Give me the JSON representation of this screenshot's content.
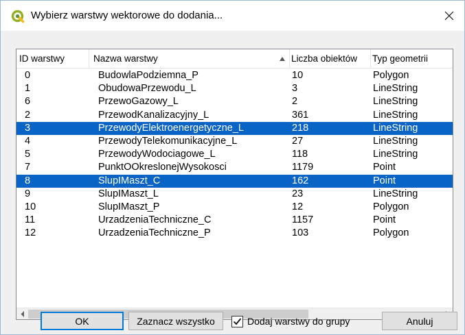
{
  "window": {
    "title": "Wybierz warstwy wektorowe do dodania...",
    "accent_color": "#0a64c5",
    "icon": "qgis-logo-icon",
    "close_icon": "close-icon"
  },
  "table": {
    "columns": [
      "ID warstwy",
      "Nazwa warstwy",
      "Liczba obiektów",
      "Typ geometrii"
    ],
    "sort_column": "Nazwa warstwy",
    "sort_direction": "ascending",
    "rows": [
      {
        "id": "0",
        "name": "BudowlaPodziemna_P",
        "count": "10",
        "type": "Polygon",
        "selected": false
      },
      {
        "id": "1",
        "name": "ObudowaPrzewodu_L",
        "count": "3",
        "type": "LineString",
        "selected": false
      },
      {
        "id": "6",
        "name": "PrzewoGazowy_L",
        "count": "2",
        "type": "LineString",
        "selected": false
      },
      {
        "id": "2",
        "name": "PrzewodKanalizacyjny_L",
        "count": "361",
        "type": "LineString",
        "selected": false
      },
      {
        "id": "3",
        "name": "PrzewodyElektroenergetyczne_L",
        "count": "218",
        "type": "LineString",
        "selected": true
      },
      {
        "id": "4",
        "name": "PrzewodyTelekomunikacyjne_L",
        "count": "27",
        "type": "LineString",
        "selected": false
      },
      {
        "id": "5",
        "name": "PrzewodyWodociagowe_L",
        "count": "118",
        "type": "LineString",
        "selected": false
      },
      {
        "id": "7",
        "name": "PunktOOkreslonejWysokosci",
        "count": "1179",
        "type": "Point",
        "selected": false
      },
      {
        "id": "8",
        "name": "SlupIMaszt_C",
        "count": "162",
        "type": "Point",
        "selected": true
      },
      {
        "id": "9",
        "name": "SlupIMaszt_L",
        "count": "23",
        "type": "LineString",
        "selected": false
      },
      {
        "id": "10",
        "name": "SlupIMaszt_P",
        "count": "12",
        "type": "Polygon",
        "selected": false
      },
      {
        "id": "11",
        "name": "UrzadzeniaTechniczne_C",
        "count": "1157",
        "type": "Point",
        "selected": false
      },
      {
        "id": "12",
        "name": "UrzadzeniaTechniczne_P",
        "count": "103",
        "type": "Polygon",
        "selected": false
      }
    ]
  },
  "buttons": {
    "ok": "OK",
    "select_all": "Zaznacz wszystko",
    "add_to_group_label": "Dodaj warstwy do grupy",
    "add_to_group_checked": true,
    "cancel": "Anuluj"
  }
}
